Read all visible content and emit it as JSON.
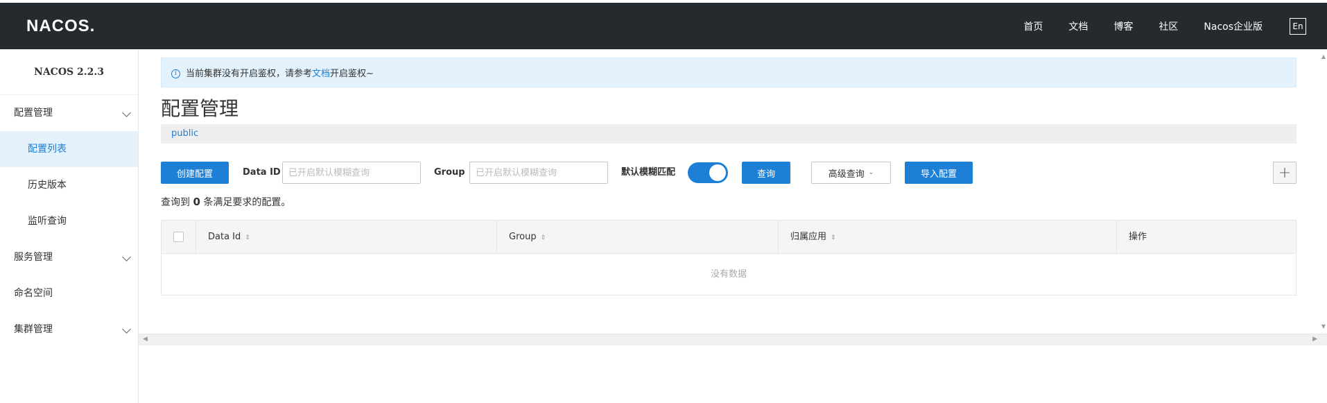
{
  "header": {
    "logo": "NACOS.",
    "nav": [
      "首页",
      "文档",
      "博客",
      "社区",
      "Nacos企业版"
    ],
    "lang": "En"
  },
  "sidebar": {
    "version": "NACOS 2.2.3",
    "items": [
      {
        "label": "配置管理",
        "expandable": true
      },
      {
        "label": "配置列表",
        "active": true
      },
      {
        "label": "历史版本"
      },
      {
        "label": "监听查询"
      },
      {
        "label": "服务管理",
        "expandable": true
      },
      {
        "label": "命名空间"
      },
      {
        "label": "集群管理",
        "expandable": true
      }
    ]
  },
  "alert": {
    "prefix": "当前集群没有开启鉴权，请参考",
    "link": "文档",
    "suffix": "开启鉴权~"
  },
  "page_title": "配置管理",
  "namespace": "public",
  "toolbar": {
    "create_label": "创建配置",
    "dataid_label": "Data ID",
    "dataid_placeholder": "已开启默认模糊查询",
    "group_label": "Group",
    "group_placeholder": "已开启默认模糊查询",
    "fuzzy_label": "默认模糊匹配",
    "fuzzy_on": true,
    "query_label": "查询",
    "advanced_label": "高级查询",
    "import_label": "导入配置",
    "plus_label": "+"
  },
  "result": {
    "prefix": "查询到",
    "count": "0",
    "suffix": "条满足要求的配置。"
  },
  "table": {
    "columns": [
      "Data Id",
      "Group",
      "归属应用",
      "操作"
    ],
    "empty_text": "没有数据"
  },
  "colors": {
    "header_bg": "#252a2f",
    "primary": "#1d7fd6",
    "active_bg": "#e5f1fb"
  }
}
